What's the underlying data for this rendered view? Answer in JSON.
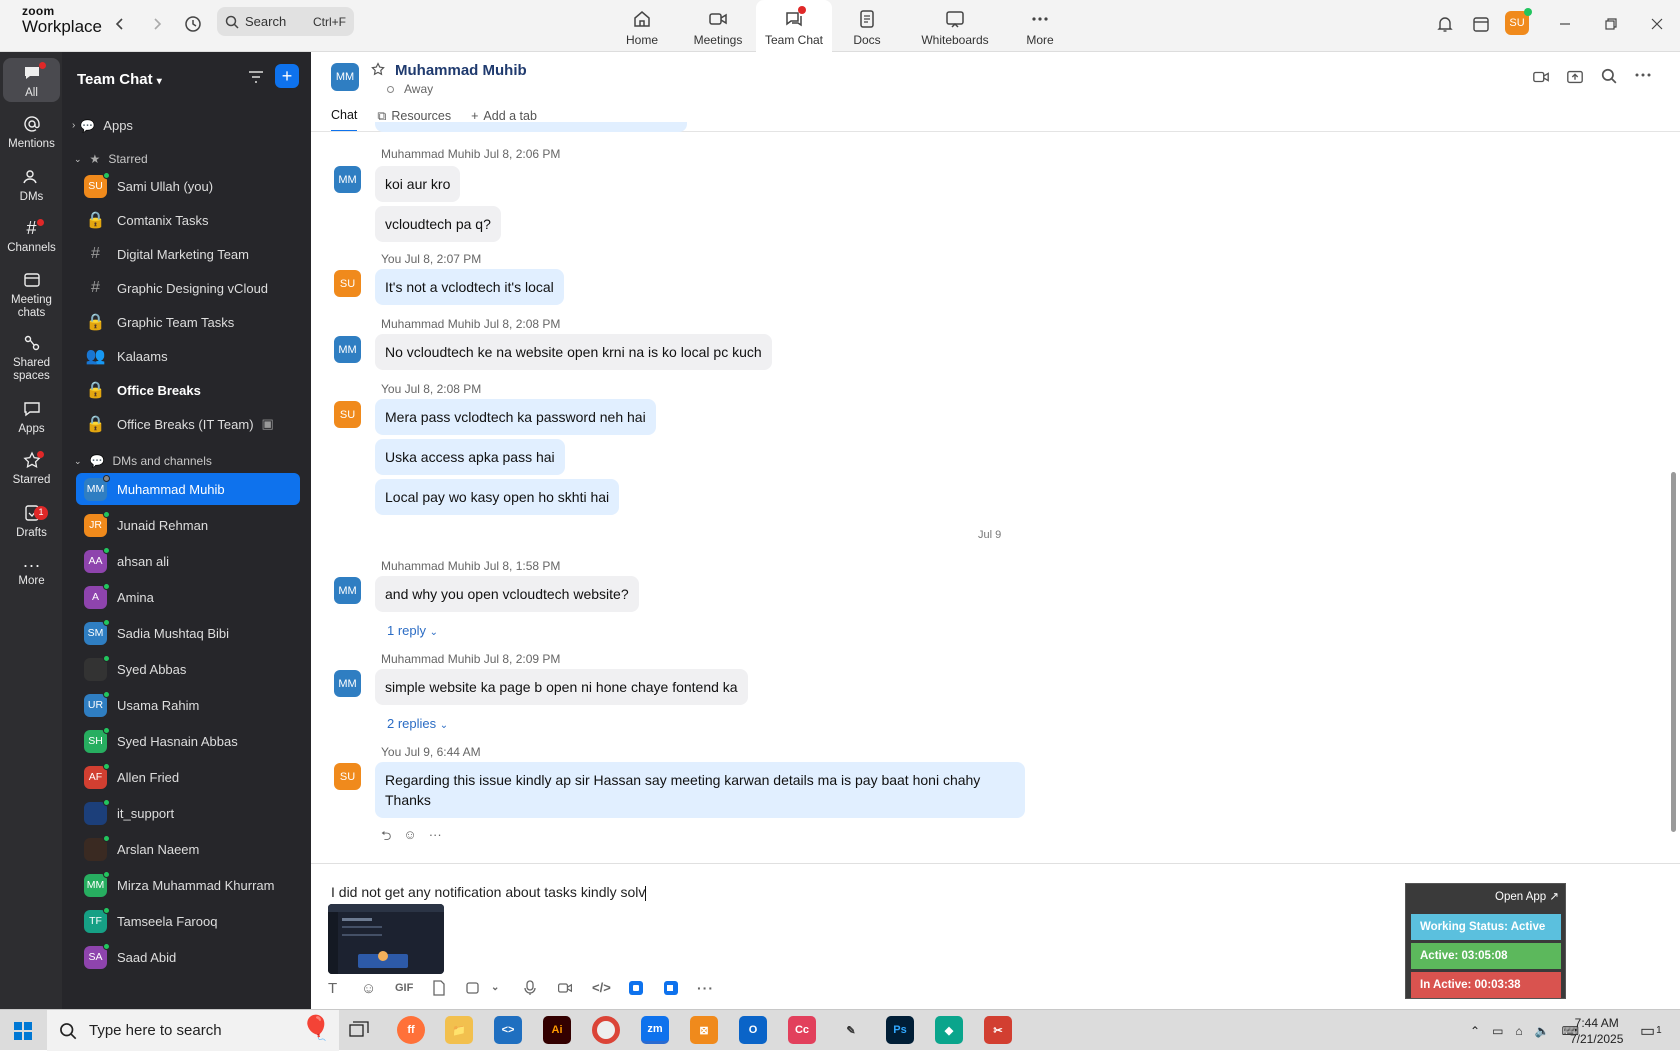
{
  "app": {
    "brand_top": "zoom",
    "brand_bottom": "Workplace"
  },
  "search": {
    "label": "Search",
    "shortcut": "Ctrl+F"
  },
  "nav": [
    {
      "label": "Home"
    },
    {
      "label": "Meetings"
    },
    {
      "label": "Team Chat"
    },
    {
      "label": "Docs"
    },
    {
      "label": "Whiteboards"
    },
    {
      "label": "More"
    }
  ],
  "user_initials": "SU",
  "rail": [
    {
      "label": "All"
    },
    {
      "label": "Mentions"
    },
    {
      "label": "DMs"
    },
    {
      "label": "Channels"
    },
    {
      "label": "Meeting chats"
    },
    {
      "label": "Shared spaces"
    },
    {
      "label": "Apps"
    },
    {
      "label": "Starred"
    },
    {
      "label": "Drafts",
      "badge": "1"
    },
    {
      "label": "More"
    }
  ],
  "sidebar": {
    "title": "Team Chat",
    "apps_label": "Apps",
    "starred_label": "Starred",
    "starred": [
      "Sami Ullah (you)",
      "Comtanix Tasks",
      "Digital Marketing Team",
      "Graphic Designing vCloud",
      "Graphic Team Tasks",
      "Kalaams",
      "Office Breaks",
      "Office Breaks (IT Team)"
    ],
    "dm_label": "DMs and channels",
    "dms": [
      {
        "initials": "MM",
        "name": "Muhammad Muhib",
        "color": "#2f7ec2"
      },
      {
        "initials": "JR",
        "name": "Junaid Rehman",
        "color": "#f08a1c"
      },
      {
        "initials": "AA",
        "name": "ahsan ali",
        "color": "#8e44ad"
      },
      {
        "initials": "A",
        "name": "Amina",
        "color": "#8e44ad"
      },
      {
        "initials": "SM",
        "name": "Sadia Mushtaq Bibi",
        "color": "#2f7ec2"
      },
      {
        "initials": "",
        "name": "Syed Abbas",
        "color": "#333"
      },
      {
        "initials": "UR",
        "name": "Usama Rahim",
        "color": "#2f7ec2"
      },
      {
        "initials": "SH",
        "name": "Syed Hasnain Abbas",
        "color": "#27ae60"
      },
      {
        "initials": "AF",
        "name": "Allen Fried",
        "color": "#d23f31"
      },
      {
        "initials": "",
        "name": "it_support",
        "color": "#1c3f7a"
      },
      {
        "initials": "",
        "name": "Arslan Naeem",
        "color": "#3a2a22"
      },
      {
        "initials": "MM",
        "name": "Mirza Muhammad Khurram",
        "color": "#27ae60"
      },
      {
        "initials": "TF",
        "name": "Tamseela Farooq",
        "color": "#16a085"
      },
      {
        "initials": "SA",
        "name": "Saad Abid",
        "color": "#8e44ad"
      }
    ]
  },
  "chat": {
    "contact_initials": "MM",
    "contact": "Muhammad Muhib",
    "status": "Away",
    "tabs": [
      "Chat",
      "Resources",
      "Add a tab"
    ],
    "messages": [
      {
        "meta": "Muhammad Muhib Jul 8, 2:06 PM",
        "lines": [
          "koi aur kro",
          "vcloudtech pa q?"
        ]
      },
      {
        "meta": "You Jul 8, 2:07 PM",
        "lines": [
          "It's not a vclodtech it's local"
        ]
      },
      {
        "meta": "Muhammad Muhib Jul 8, 2:08 PM",
        "lines": [
          "No vcloudtech ke na website open krni na is ko local pc kuch"
        ]
      },
      {
        "meta": "You Jul 8, 2:08 PM",
        "lines": [
          "Mera pass vclodtech ka password neh hai",
          "Uska access apka pass hai",
          "Local pay wo kasy open ho skhti hai"
        ]
      },
      {
        "meta": "Muhammad Muhib Jul 8, 1:58 PM",
        "lines": [
          "and why you open vcloudtech website?"
        ],
        "reply": "1 reply"
      },
      {
        "meta": "Muhammad Muhib Jul 8, 2:09 PM",
        "lines": [
          "simple website ka page b open ni hone chaye fontend ka"
        ],
        "reply": "2 replies"
      },
      {
        "meta": "You Jul 9, 6:44 AM",
        "lines": [
          "Regarding this issue kindly ap sir Hassan say meeting karwan details ma is pay baat honi chahy",
          "Thanks"
        ]
      }
    ],
    "date_sep": "Jul 9",
    "draft": "I did not get any notification about tasks kindly solv"
  },
  "composer_tools": {
    "gif": "GIF"
  },
  "widget": {
    "open": "Open App ↗",
    "working": "Working Status: Active",
    "active": "Active: 03:05:08",
    "inactive": "In Active: 00:03:38"
  },
  "taskbar": {
    "search": "Type here to search",
    "time": "7:44 AM",
    "date": "7/21/2025",
    "notif_count": "1"
  }
}
